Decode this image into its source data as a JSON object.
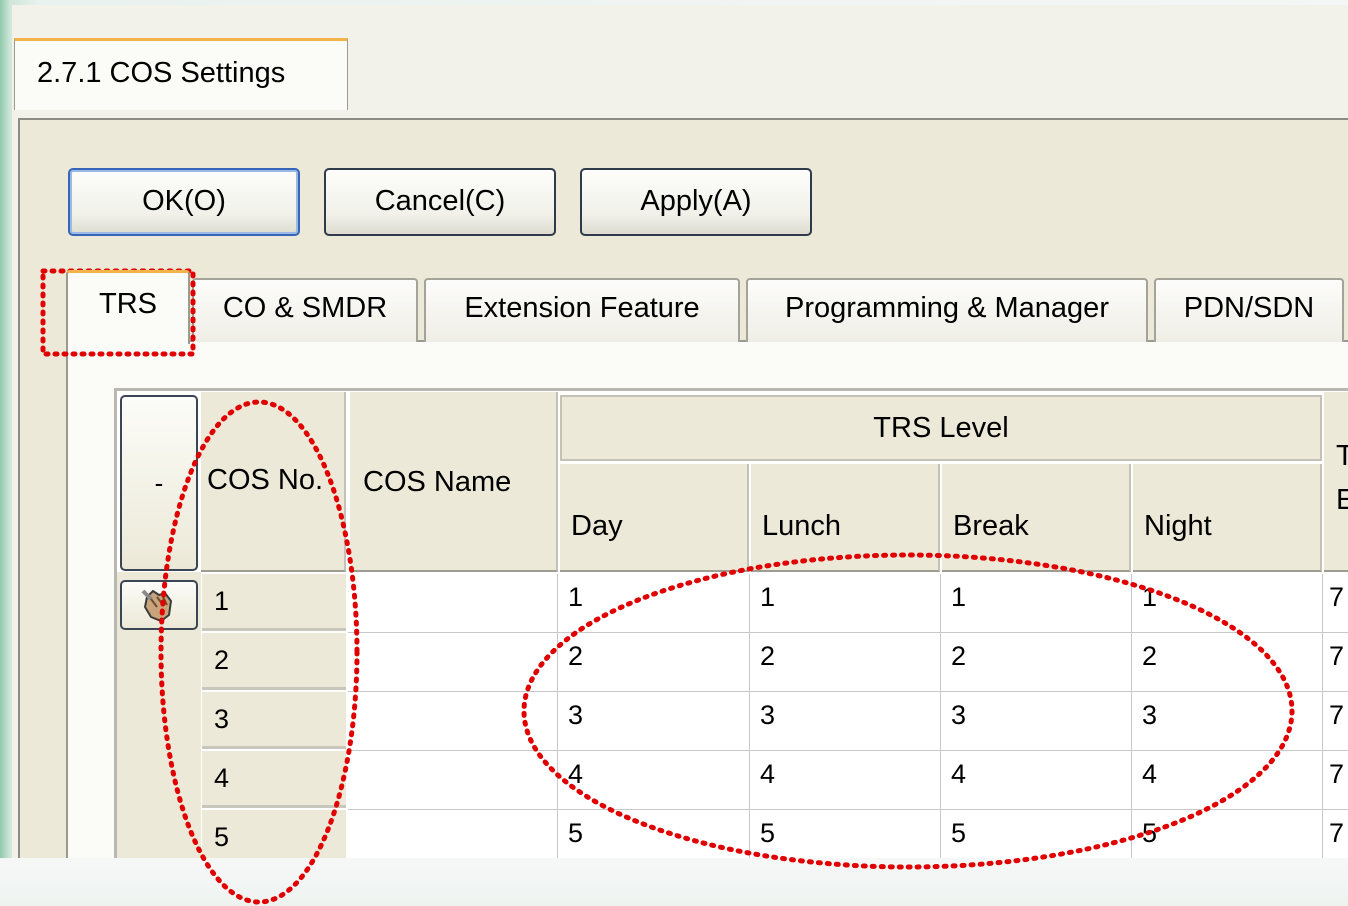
{
  "window": {
    "title_tab": "2.7.1 COS Settings"
  },
  "buttons": {
    "ok": "OK(O)",
    "cancel": "Cancel(C)",
    "apply": "Apply(A)"
  },
  "tabs": [
    "TRS",
    "CO & SMDR",
    "Extension Feature",
    "Programming & Manager",
    "PDN/SDN"
  ],
  "table": {
    "corner_label": "-",
    "headers": {
      "cos_no": "COS No.",
      "cos_name": "COS Name",
      "trs_level": "TRS Level",
      "day": "Day",
      "lunch": "Lunch",
      "break": "Break",
      "night": "Night",
      "extra_top": "T",
      "extra_bottom": "E"
    },
    "rows": [
      {
        "no": "1",
        "name": "",
        "day": "1",
        "lunch": "1",
        "break": "1",
        "night": "1",
        "extra": "7"
      },
      {
        "no": "2",
        "name": "",
        "day": "2",
        "lunch": "2",
        "break": "2",
        "night": "2",
        "extra": "7"
      },
      {
        "no": "3",
        "name": "",
        "day": "3",
        "lunch": "3",
        "break": "3",
        "night": "3",
        "extra": "7"
      },
      {
        "no": "4",
        "name": "",
        "day": "4",
        "lunch": "4",
        "break": "4",
        "night": "4",
        "extra": "7"
      },
      {
        "no": "5",
        "name": "",
        "day": "5",
        "lunch": "5",
        "break": "5",
        "night": "5",
        "extra": "7"
      }
    ]
  },
  "annotations": {
    "highlight_color": "#e00000",
    "pointer_icon": "hand-pointer-icon"
  }
}
